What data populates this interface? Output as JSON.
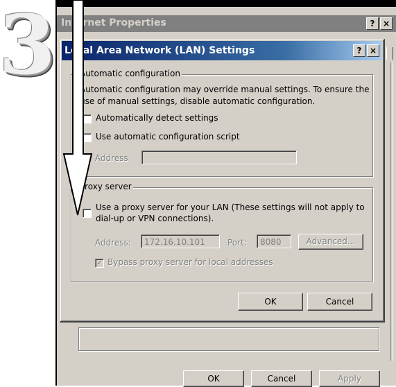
{
  "step_number": "3",
  "outer_window": {
    "title": "Internet Properties",
    "help_button": "?",
    "close_button": "×",
    "buttons": {
      "ok": "OK",
      "cancel": "Cancel",
      "apply": "Apply"
    }
  },
  "lan_dialog": {
    "title": "Local Area Network (LAN) Settings",
    "help_button": "?",
    "close_button": "×",
    "automatic_configuration": {
      "group_label": "Automatic configuration",
      "description": [
        "Automatic configuration may override manual settings.  To ensure the",
        "use of manual settings, disable automatic configuration."
      ],
      "auto_detect_label": "Automatically detect settings",
      "use_script_label": "Use automatic configuration script",
      "address_label": "Address",
      "address_value": ""
    },
    "proxy_server": {
      "group_label": "Proxy server",
      "use_proxy_label": [
        "Use a proxy server for your LAN (These settings will not apply to",
        "dial-up or VPN connections)."
      ],
      "address_label": "Address:",
      "address_value": "172.16.10.101",
      "port_label": "Port:",
      "port_value": "8080",
      "advanced_button": "Advanced...",
      "bypass_label": "Bypass proxy server for local addresses"
    },
    "buttons": {
      "ok": "OK",
      "cancel": "Cancel"
    }
  },
  "colors": {
    "dialog_face": "#d4d0c8",
    "title_active_start": "#0a246a",
    "title_active_end": "#a6caf0",
    "title_inactive": "#808080"
  }
}
